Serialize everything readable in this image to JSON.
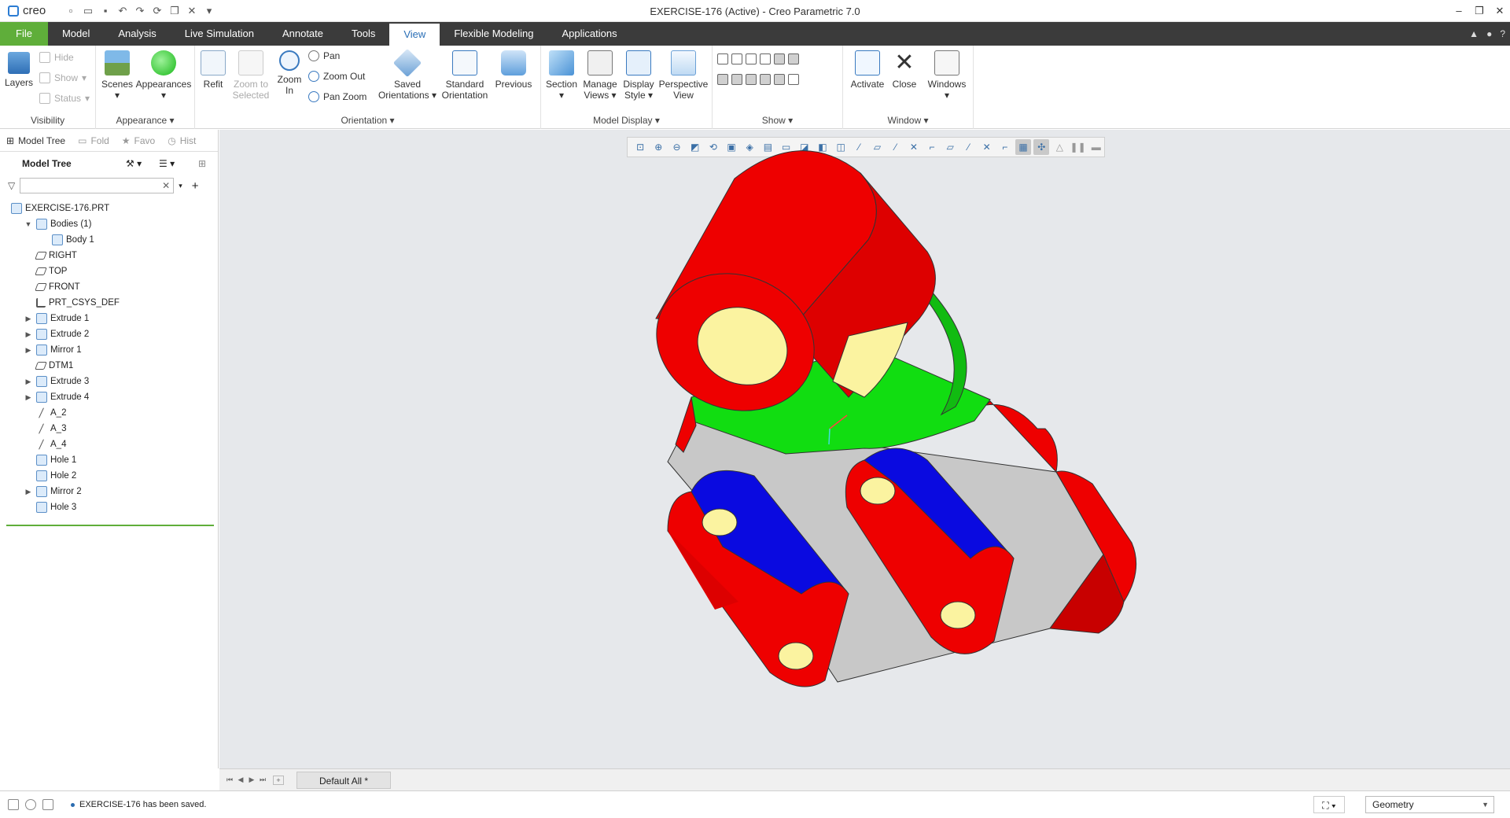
{
  "app": {
    "logo": "creo",
    "window_title": "EXERCISE-176 (Active) - Creo Parametric 7.0"
  },
  "quick_access": [
    "new",
    "open",
    "save",
    "undo",
    "redo",
    "regenerate",
    "windows",
    "close"
  ],
  "menu": {
    "items": [
      "File",
      "Model",
      "Analysis",
      "Live Simulation",
      "Annotate",
      "Tools",
      "View",
      "Flexible Modeling",
      "Applications"
    ],
    "active": "View"
  },
  "ribbon": {
    "visibility": {
      "label": "Visibility",
      "layers": "Layers",
      "hide": "Hide",
      "show": "Show",
      "status": "Status"
    },
    "appearance": {
      "label": "Appearance",
      "scenes": "Scenes",
      "appearances": "Appearances"
    },
    "orientation": {
      "label": "Orientation",
      "refit": "Refit",
      "zoom_to_selected": "Zoom to Selected",
      "zoom_in": "Zoom In",
      "pan": "Pan",
      "zoom_out": "Zoom Out",
      "pan_zoom": "Pan Zoom",
      "saved_orientations": "Saved Orientations",
      "standard_orientation": "Standard Orientation",
      "previous": "Previous"
    },
    "model_display": {
      "label": "Model Display",
      "section": "Section",
      "manage_views": "Manage Views",
      "display_style": "Display Style",
      "perspective_view": "Perspective View"
    },
    "show": {
      "label": "Show"
    },
    "window": {
      "label": "Window",
      "activate": "Activate",
      "close": "Close",
      "windows": "Windows"
    }
  },
  "panel": {
    "tabs": [
      "Model Tree",
      "Fold",
      "Favo",
      "Hist"
    ],
    "tree_title": "Model Tree",
    "filter_placeholder": "",
    "items": [
      {
        "label": "EXERCISE-176.PRT",
        "indent": 0,
        "expander": "",
        "icon": "part"
      },
      {
        "label": "Bodies (1)",
        "indent": 1,
        "expander": "open",
        "icon": "bodies"
      },
      {
        "label": "Body 1",
        "indent": 2,
        "expander": "",
        "icon": "body"
      },
      {
        "label": "RIGHT",
        "indent": 1,
        "expander": "",
        "icon": "plane"
      },
      {
        "label": "TOP",
        "indent": 1,
        "expander": "",
        "icon": "plane"
      },
      {
        "label": "FRONT",
        "indent": 1,
        "expander": "",
        "icon": "plane"
      },
      {
        "label": "PRT_CSYS_DEF",
        "indent": 1,
        "expander": "",
        "icon": "csys"
      },
      {
        "label": "Extrude 1",
        "indent": 1,
        "expander": "closed",
        "icon": "feature"
      },
      {
        "label": "Extrude 2",
        "indent": 1,
        "expander": "closed",
        "icon": "feature"
      },
      {
        "label": "Mirror 1",
        "indent": 1,
        "expander": "closed",
        "icon": "feature"
      },
      {
        "label": "DTM1",
        "indent": 1,
        "expander": "",
        "icon": "plane"
      },
      {
        "label": "Extrude 3",
        "indent": 1,
        "expander": "closed",
        "icon": "feature"
      },
      {
        "label": "Extrude 4",
        "indent": 1,
        "expander": "closed",
        "icon": "feature"
      },
      {
        "label": "A_2",
        "indent": 1,
        "expander": "",
        "icon": "axis"
      },
      {
        "label": "A_3",
        "indent": 1,
        "expander": "",
        "icon": "axis"
      },
      {
        "label": "A_4",
        "indent": 1,
        "expander": "",
        "icon": "axis"
      },
      {
        "label": "Hole 1",
        "indent": 1,
        "expander": "",
        "icon": "feature"
      },
      {
        "label": "Hole 2",
        "indent": 1,
        "expander": "",
        "icon": "feature"
      },
      {
        "label": "Mirror 2",
        "indent": 1,
        "expander": "closed",
        "icon": "feature"
      },
      {
        "label": "Hole 3",
        "indent": 1,
        "expander": "",
        "icon": "feature"
      }
    ]
  },
  "bottom": {
    "view_tab": "Default All *"
  },
  "status": {
    "message": "EXERCISE-176 has been saved.",
    "selection_filter": "Geometry"
  },
  "colors": {
    "red": "#ee0000",
    "green": "#11dd11",
    "blue": "#0a0ae0",
    "gray": "#c8c8c8",
    "hole": "#fbf3a0"
  }
}
